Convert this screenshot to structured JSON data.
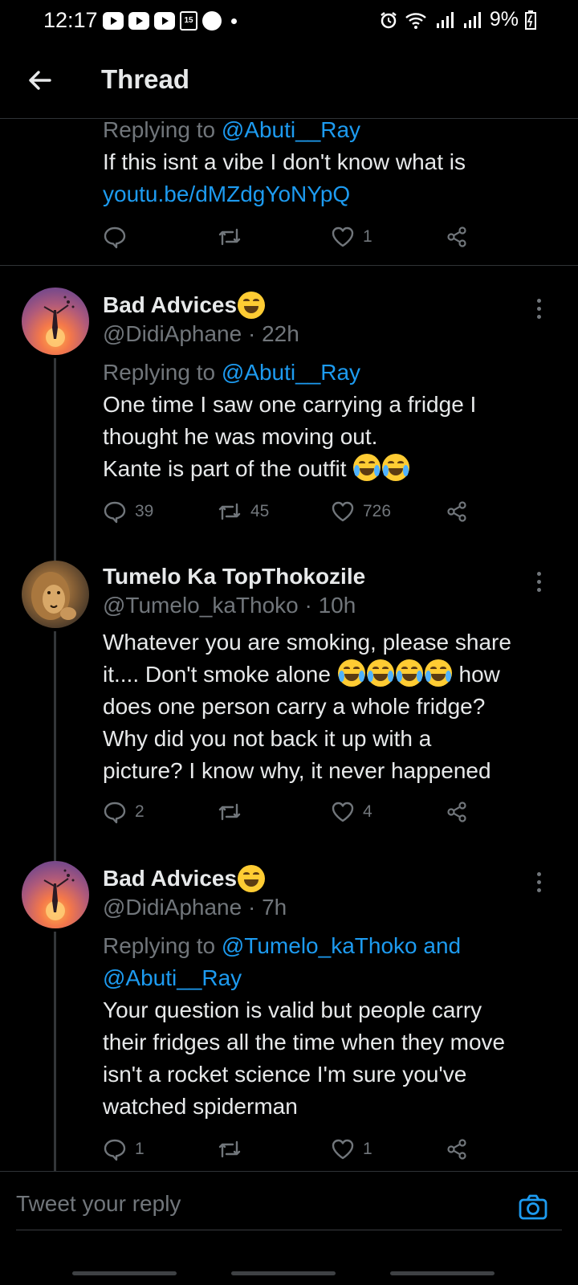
{
  "status_bar": {
    "time": "12:17",
    "battery": "9%",
    "calendar_day": "15"
  },
  "header": {
    "title": "Thread"
  },
  "top_tweet": {
    "replying_prefix": "Replying to",
    "replying_handle": "@Abuti__Ray",
    "text": "If this isnt a vibe I don't know what is",
    "link": "youtu.be/dMZdgYoNYpQ",
    "replies": "",
    "retweets": "",
    "likes": "1"
  },
  "tweets": [
    {
      "name": "Bad Advices",
      "handle": "@DidiAphane",
      "time": "22h",
      "replying_prefix": "Replying to",
      "replying_handle": "@Abuti__Ray",
      "text_lines": [
        "One time I saw one carrying a fridge I",
        "thought he was moving out.",
        "Kante is part of the outfit"
      ],
      "replies": "39",
      "retweets": "45",
      "likes": "726"
    },
    {
      "name": "Tumelo Ka TopThokozile",
      "handle": "@Tumelo_kaThoko",
      "time": "10h",
      "text_lines": [
        "Whatever you are smoking, please share",
        "it.... Don't smoke alone",
        "how",
        "does one person carry a whole fridge?",
        "Why did you not back it up with a",
        "picture? I know why, it never happened"
      ],
      "replies": "2",
      "retweets": "",
      "likes": "4"
    },
    {
      "name": "Bad Advices",
      "handle": "@DidiAphane",
      "time": "7h",
      "replying_prefix": "Replying to",
      "replying_handle": "@Tumelo_kaThoko and",
      "replying_handle_2": "@Abuti__Ray",
      "text_lines": [
        "Your question is valid but people carry",
        "their fridges all the time when they move",
        "isn't a rocket science I'm sure you've",
        "watched spiderman"
      ],
      "replies": "1",
      "retweets": "",
      "likes": "1"
    }
  ],
  "reply_bar": {
    "placeholder": "Tweet your reply"
  },
  "colors": {
    "accent": "#1d9bf0",
    "muted": "#71767b",
    "text": "#e7e9ea",
    "background": "#000000"
  },
  "icons": [
    "back-arrow-icon",
    "reply-icon",
    "retweet-icon",
    "like-icon",
    "share-icon",
    "more-icon",
    "camera-icon"
  ]
}
